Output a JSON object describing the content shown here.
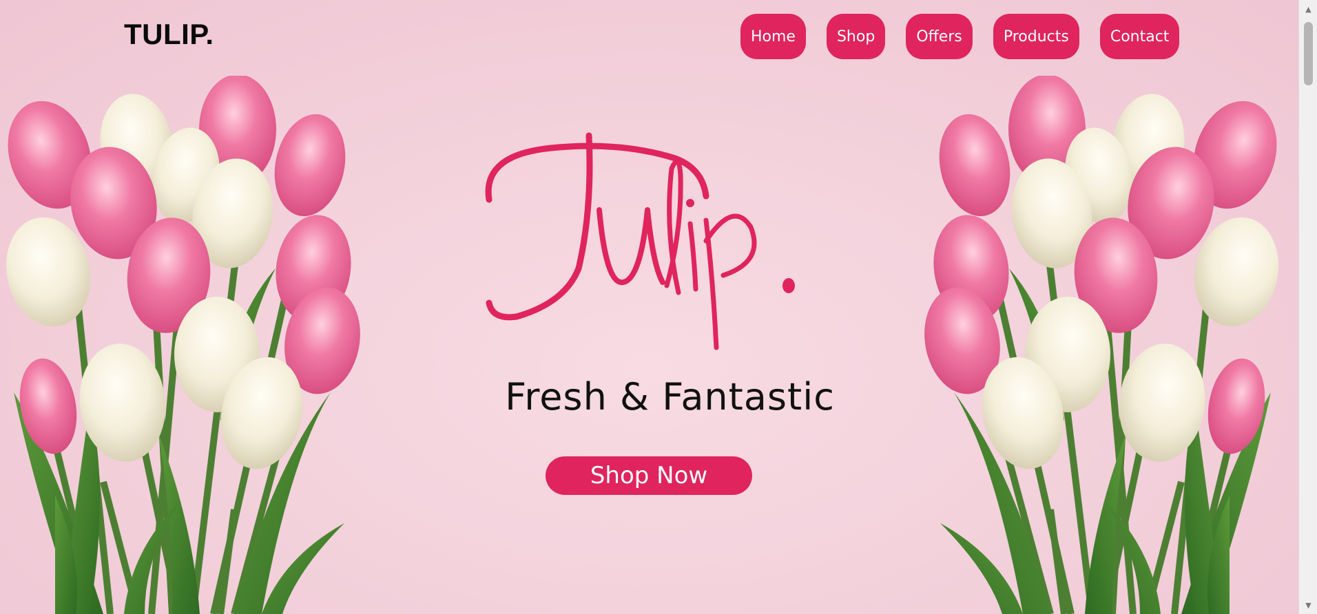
{
  "brand": {
    "logo": "TULIP."
  },
  "nav": {
    "items": [
      {
        "label": "Home"
      },
      {
        "label": "Shop"
      },
      {
        "label": "Offers"
      },
      {
        "label": "Products"
      },
      {
        "label": "Contact"
      }
    ]
  },
  "hero": {
    "script_title": "Tulip.",
    "tagline": "Fresh & Fantastic",
    "cta_label": "Shop Now"
  },
  "colors": {
    "accent": "#e0245e",
    "background": "#f3d2dc",
    "text": "#111111"
  },
  "scrollbar": {
    "up_icon": "chevron-up-icon",
    "down_icon": "chevron-down-icon"
  }
}
